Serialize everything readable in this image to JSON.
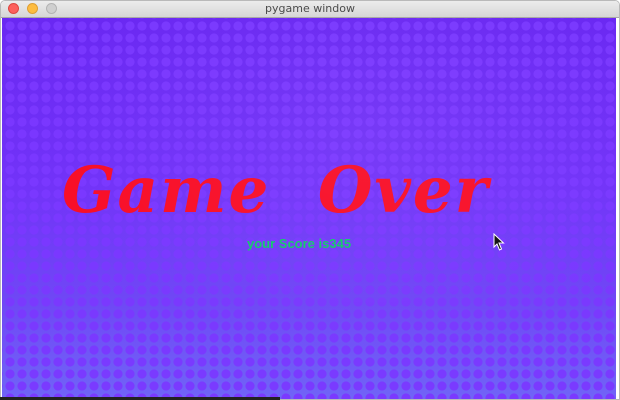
{
  "window": {
    "title": "pygame window",
    "controls": [
      "close-icon",
      "minimize-icon",
      "zoom-icon"
    ]
  },
  "game": {
    "headline": "Game  Over",
    "score_text": "your Score is345",
    "colors": {
      "background": "#6f2cf3",
      "dots": "#7a38ff",
      "headline": "#f80f28",
      "score": "#13c86c"
    }
  },
  "cursor": {
    "icon": "mouse-pointer-icon"
  }
}
